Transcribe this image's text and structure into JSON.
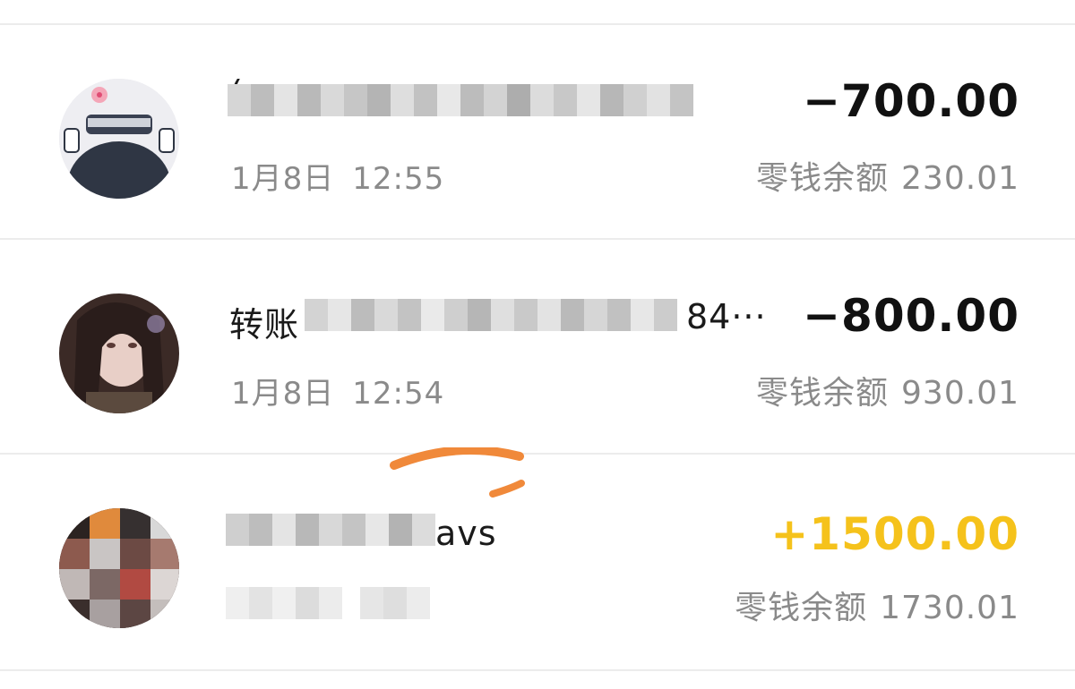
{
  "transactions": [
    {
      "title": "(",
      "date": "1月8日",
      "time": "12:55",
      "amount": "−700.00",
      "balance_label": "零钱余额",
      "balance": "230.01",
      "amount_color": "#111111"
    },
    {
      "title": "转账",
      "title_suffix": "84···",
      "date": "1月8日",
      "time": "12:54",
      "amount": "−800.00",
      "balance_label": "零钱余额",
      "balance": "930.01",
      "amount_color": "#111111"
    },
    {
      "title_suffix": "avs",
      "amount": "+1500.00",
      "balance_label": "零钱余额",
      "balance": "1730.01",
      "amount_color": "#f5c21b"
    }
  ],
  "icons": {
    "avatar_1": "avatar-icon",
    "avatar_2": "avatar-icon",
    "avatar_3": "avatar-icon"
  }
}
